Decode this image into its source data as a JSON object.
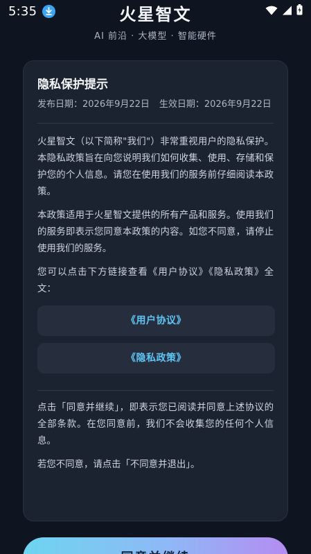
{
  "status_bar": {
    "time": "5:35",
    "icons": [
      "download-icon",
      "wifi-icon",
      "signal-icon",
      "battery-icon"
    ],
    "accent_download": "#3aa6f2"
  },
  "header": {
    "title": "火星智文",
    "subtitle": "AI 前沿 · 大模型 · 智能硬件"
  },
  "policy": {
    "title": "隐私保护提示",
    "publish_date": "发布日期：2026年9月22日",
    "effective_date": "生效日期：2026年9月22日",
    "paragraphs": [
      "火星智文（以下简称\"我们\"）非常重视用户的隐私保护。本隐私政策旨在向您说明我们如何收集、使用、存储和保护您的个人信息。请您在使用我们的服务前仔细阅读本政策。",
      "本政策适用于火星智文提供的所有产品和服务。使用我们的服务即表示您同意本政策的内容。如您不同意，请停止使用我们的服务。",
      "您可以点击下方链接查看《用户协议》《隐私政策》全文："
    ],
    "links": [
      "《用户协议》",
      "《隐私政策》"
    ],
    "footer_paragraphs": [
      "点击「同意并继续」，即表示您已阅读并同意上述协议的全部条款。在您同意前，我们不会收集您的任何个人信息。",
      "若您不同意，请点击「不同意并退出」。"
    ]
  },
  "actions": {
    "agree_label": "同意并继续"
  },
  "colors": {
    "background": "#0f1520",
    "card": "#1b2230",
    "link": "#5ec6f5",
    "button_gradient_start": "#6dd5f0",
    "button_gradient_end": "#b48cf2"
  }
}
